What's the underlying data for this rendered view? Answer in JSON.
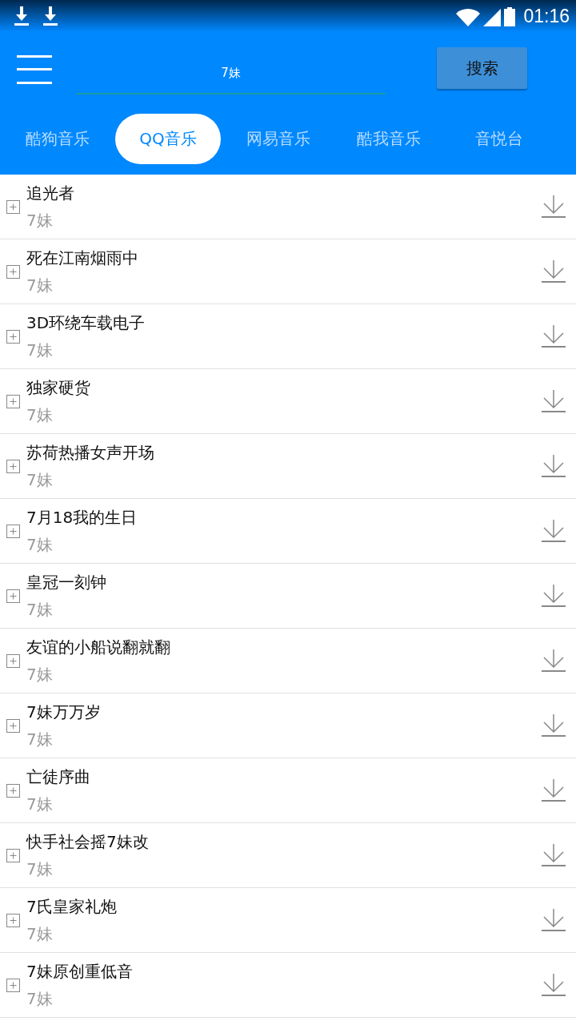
{
  "status_bar": {
    "time": "01:16"
  },
  "search": {
    "value": "7妹",
    "button": "搜索"
  },
  "tabs": [
    {
      "label": "酷狗音乐",
      "selected": false
    },
    {
      "label": "QQ音乐",
      "selected": true
    },
    {
      "label": "网易音乐",
      "selected": false
    },
    {
      "label": "酷我音乐",
      "selected": false
    },
    {
      "label": "音悦台",
      "selected": false
    }
  ],
  "songs": [
    {
      "title": "追光者",
      "artist": "7妹"
    },
    {
      "title": "死在江南烟雨中",
      "artist": "7妹"
    },
    {
      "title": "3D环绕车载电子",
      "artist": "7妹"
    },
    {
      "title": "独家硬货",
      "artist": "7妹"
    },
    {
      "title": "苏荷热播女声开场",
      "artist": "7妹"
    },
    {
      "title": "7月18我的生日",
      "artist": "7妹"
    },
    {
      "title": "皇冠一刻钟",
      "artist": "7妹"
    },
    {
      "title": "友谊的小船说翻就翻",
      "artist": "7妹"
    },
    {
      "title": "7妹万万岁",
      "artist": "7妹"
    },
    {
      "title": "亡徒序曲",
      "artist": "7妹"
    },
    {
      "title": "快手社会摇7妹改",
      "artist": "7妹"
    },
    {
      "title": "7氏皇家礼炮",
      "artist": "7妹"
    },
    {
      "title": "7妹原创重低音",
      "artist": "7妹"
    }
  ]
}
